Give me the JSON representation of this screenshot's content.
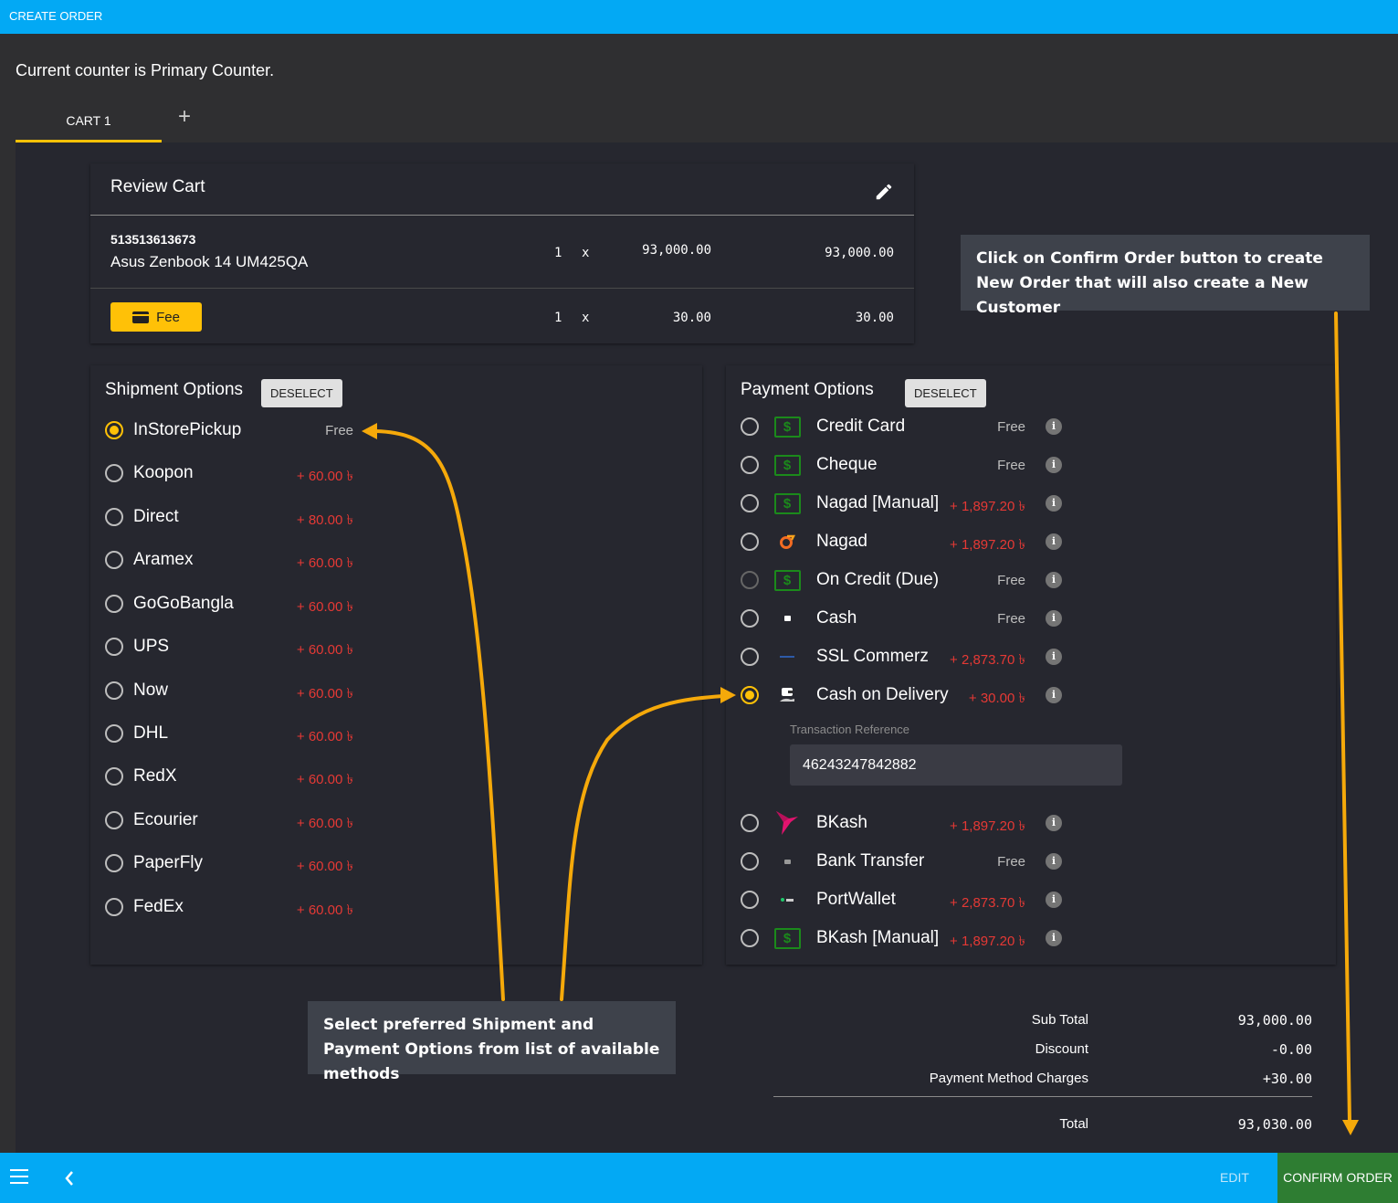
{
  "app": {
    "title": "CREATE ORDER"
  },
  "counter_text": "Current counter is Primary Counter.",
  "tabs": [
    {
      "label": "CART 1",
      "active": true
    }
  ],
  "add_tab_label": "+",
  "review_cart": {
    "title": "Review Cart",
    "items": [
      {
        "sku": "513513613673",
        "name": "Asus Zenbook 14 UM425QA",
        "qty": "1",
        "x": "x",
        "price": "93,000.00",
        "total": "93,000.00"
      }
    ],
    "fee_row": {
      "label": "Fee",
      "qty": "1",
      "x": "x",
      "price": "30.00",
      "total": "30.00"
    }
  },
  "shipment": {
    "title": "Shipment Options",
    "deselect_label": "DESELECT",
    "options": [
      {
        "name": "InStorePickup",
        "fee": "Free",
        "selected": true
      },
      {
        "name": "Koopon",
        "fee": "+ 60.00 ৳"
      },
      {
        "name": "Direct",
        "fee": "+ 80.00 ৳"
      },
      {
        "name": "Aramex",
        "fee": "+ 60.00 ৳"
      },
      {
        "name": "GoGoBangla",
        "fee": "+ 60.00 ৳"
      },
      {
        "name": "UPS",
        "fee": "+ 60.00 ৳"
      },
      {
        "name": "Now",
        "fee": "+ 60.00 ৳"
      },
      {
        "name": "DHL",
        "fee": "+ 60.00 ৳"
      },
      {
        "name": "RedX",
        "fee": "+ 60.00 ৳"
      },
      {
        "name": "Ecourier",
        "fee": "+ 60.00 ৳"
      },
      {
        "name": "PaperFly",
        "fee": "+ 60.00 ৳"
      },
      {
        "name": "FedEx",
        "fee": "+ 60.00 ৳"
      }
    ]
  },
  "payment": {
    "title": "Payment Options",
    "deselect_label": "DESELECT",
    "info_glyph": "i",
    "options": [
      {
        "name": "Credit Card",
        "fee": "Free",
        "icon": "dollar-box-icon"
      },
      {
        "name": "Cheque",
        "fee": "Free",
        "icon": "dollar-box-icon"
      },
      {
        "name": "Nagad [Manual]",
        "fee": "+ 1,897.20 ৳",
        "icon": "dollar-box-icon"
      },
      {
        "name": "Nagad",
        "fee": "+ 1,897.20 ৳",
        "icon": "nagad-logo-icon"
      },
      {
        "name": "On Credit (Due)",
        "fee": "Free",
        "icon": "dollar-box-icon",
        "disabled": true
      },
      {
        "name": "Cash",
        "fee": "Free",
        "icon": "cash-icon"
      },
      {
        "name": "SSL Commerz",
        "fee": "+ 2,873.70 ৳",
        "icon": "sslcommerz-logo-icon"
      },
      {
        "name": "Cash on Delivery",
        "fee": "+ 30.00 ৳",
        "icon": "cash-on-delivery-icon",
        "selected": true
      },
      {
        "name": "BKash",
        "fee": "+ 1,897.20 ৳",
        "icon": "bkash-logo-icon"
      },
      {
        "name": "Bank Transfer",
        "fee": "Free",
        "icon": "bank-card-icon"
      },
      {
        "name": "PortWallet",
        "fee": "+ 2,873.70 ৳",
        "icon": "portwallet-logo-icon"
      },
      {
        "name": "BKash [Manual]",
        "fee": "+ 1,897.20 ৳",
        "icon": "dollar-box-icon"
      }
    ],
    "transaction_reference": {
      "label": "Transaction Reference",
      "value": "46243247842882"
    }
  },
  "totals": {
    "sub_total_label": "Sub Total",
    "sub_total": "93,000.00",
    "discount_label": "Discount",
    "discount": "-0.00",
    "charges_label": "Payment Method Charges",
    "charges": "+30.00",
    "total_label": "Total",
    "total": "93,030.00"
  },
  "callouts": {
    "confirm": "Click on Confirm Order button to create New Order that will also create a New Customer",
    "select": "Select preferred Shipment and Payment Options from list of available methods"
  },
  "bottom_bar": {
    "edit_label": "EDIT",
    "confirm_label": "CONFIRM ORDER"
  },
  "colors": {
    "primary": "#03a9f4",
    "accent": "#ffc107",
    "confirm": "#2e7d32",
    "fee_red": "#e53935",
    "annotation": "#f5a90a"
  }
}
